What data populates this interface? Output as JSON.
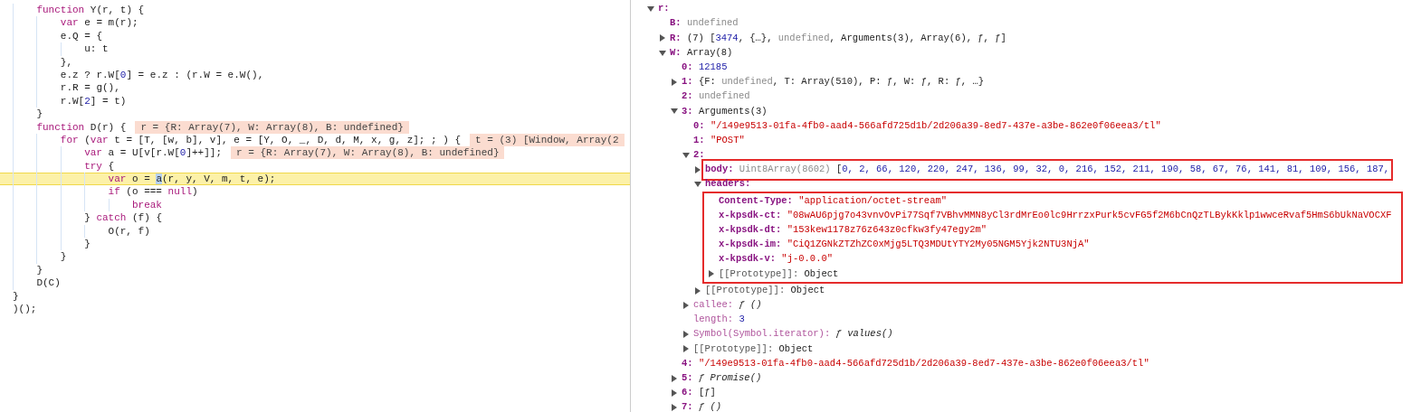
{
  "source": {
    "lines": [
      {
        "tokens": [
          {
            "kind": "kw",
            "text": "    function"
          },
          {
            "kind": "plain",
            "text": " Y(r, t) {"
          }
        ]
      },
      {
        "tokens": [
          {
            "kind": "kw",
            "text": "        var"
          },
          {
            "kind": "plain",
            "text": " e = m(r);"
          }
        ]
      },
      {
        "tokens": [
          {
            "kind": "plain",
            "text": "        e.Q = {"
          }
        ]
      },
      {
        "tokens": [
          {
            "kind": "plain",
            "text": "            u: t"
          }
        ]
      },
      {
        "tokens": [
          {
            "kind": "plain",
            "text": "        },"
          }
        ]
      },
      {
        "tokens": [
          {
            "kind": "plain",
            "text": "        e.z ? r.W["
          },
          {
            "kind": "num",
            "text": "0"
          },
          {
            "kind": "plain",
            "text": "] = e.z : (r.W = e.W(),"
          }
        ]
      },
      {
        "tokens": [
          {
            "kind": "plain",
            "text": "        r.R = g(),"
          }
        ]
      },
      {
        "tokens": [
          {
            "kind": "plain",
            "text": "        r.W["
          },
          {
            "kind": "num",
            "text": "2"
          },
          {
            "kind": "plain",
            "text": "] = t)"
          }
        ]
      },
      {
        "tokens": [
          {
            "kind": "plain",
            "text": "    }"
          }
        ]
      },
      {
        "tokens": [
          {
            "kind": "kw",
            "text": "    function"
          },
          {
            "kind": "plain",
            "text": " D(r) {"
          }
        ],
        "annotation": "r = {R: Array(7), W: Array(8), B: undefined}"
      },
      {
        "tokens": [
          {
            "kind": "kw",
            "text": "        for"
          },
          {
            "kind": "plain",
            "text": " ("
          },
          {
            "kind": "kw",
            "text": "var"
          },
          {
            "kind": "plain",
            "text": " t = [T, [w, b], v], e = [Y, O, _, D, d, M, x, g, z]; ; ) {"
          }
        ],
        "annotation": "t = (3) [Window, Array(2"
      },
      {
        "tokens": [
          {
            "kind": "kw",
            "text": "            var"
          },
          {
            "kind": "plain",
            "text": " a = U[v[r.W["
          },
          {
            "kind": "num",
            "text": "0"
          },
          {
            "kind": "plain",
            "text": "]++]];"
          }
        ],
        "annotation": "r = {R: Array(7), W: Array(8), B: undefined}"
      },
      {
        "tokens": [
          {
            "kind": "kw",
            "text": "            try"
          },
          {
            "kind": "plain",
            "text": " {"
          }
        ]
      },
      {
        "tokens": [
          {
            "kind": "kw",
            "text": "                var"
          },
          {
            "kind": "plain",
            "text": " o = "
          },
          {
            "kind": "sel",
            "text": "a"
          },
          {
            "kind": "plain",
            "text": "(r, y, V, m, t, e);"
          }
        ],
        "current": true
      },
      {
        "tokens": [
          {
            "kind": "kw",
            "text": "                if"
          },
          {
            "kind": "plain",
            "text": " (o === "
          },
          {
            "kind": "kw",
            "text": "null"
          },
          {
            "kind": "plain",
            "text": ")"
          }
        ]
      },
      {
        "tokens": [
          {
            "kind": "kw",
            "text": "                    break"
          }
        ]
      },
      {
        "tokens": [
          {
            "kind": "plain",
            "text": "            } "
          },
          {
            "kind": "kw",
            "text": "catch"
          },
          {
            "kind": "plain",
            "text": " (f) {"
          }
        ]
      },
      {
        "tokens": [
          {
            "kind": "plain",
            "text": "                O(r, f)"
          }
        ]
      },
      {
        "tokens": [
          {
            "kind": "plain",
            "text": "            }"
          }
        ]
      },
      {
        "tokens": [
          {
            "kind": "plain",
            "text": "        }"
          }
        ]
      },
      {
        "tokens": [
          {
            "kind": "plain",
            "text": "    }"
          }
        ]
      },
      {
        "tokens": [
          {
            "kind": "plain",
            "text": "    D(C)"
          }
        ]
      },
      {
        "tokens": [
          {
            "kind": "plain",
            "text": "}"
          }
        ]
      },
      {
        "tokens": [
          {
            "kind": "plain",
            "text": ")();"
          }
        ]
      }
    ]
  },
  "scope": {
    "tree": [
      {
        "key": "r:",
        "kind": "own",
        "expanded": true,
        "children": [
          {
            "key": "B:",
            "kind": "own",
            "value": [
              {
                "kind": "undef",
                "text": "undefined"
              }
            ]
          },
          {
            "key": "R:",
            "kind": "own",
            "expanded": false,
            "value": [
              {
                "kind": "plain",
                "text": "(7) ["
              },
              {
                "kind": "num",
                "text": "3474"
              },
              {
                "kind": "plain",
                "text": ", {…}, "
              },
              {
                "kind": "undef",
                "text": "undefined"
              },
              {
                "kind": "plain",
                "text": ", Arguments(3), Array(6), ƒ, ƒ]"
              }
            ]
          },
          {
            "key": "W:",
            "kind": "own",
            "expanded": true,
            "value": [
              {
                "kind": "plain",
                "text": "Array(8)"
              }
            ],
            "children": [
              {
                "key": "0:",
                "kind": "index",
                "value": [
                  {
                    "kind": "num",
                    "text": "12185"
                  }
                ]
              },
              {
                "key": "1:",
                "kind": "index",
                "expanded": false,
                "value": [
                  {
                    "kind": "plain",
                    "text": "{F: "
                  },
                  {
                    "kind": "undef",
                    "text": "undefined"
                  },
                  {
                    "kind": "plain",
                    "text": ", T: Array(510), P: ƒ, W: ƒ, R: ƒ, …}"
                  }
                ]
              },
              {
                "key": "2:",
                "kind": "index",
                "value": [
                  {
                    "kind": "undef",
                    "text": "undefined"
                  }
                ]
              },
              {
                "key": "3:",
                "kind": "index",
                "expanded": true,
                "value": [
                  {
                    "kind": "plain",
                    "text": "Arguments(3)"
                  }
                ],
                "children": [
                  {
                    "key": "0:",
                    "kind": "index",
                    "value": [
                      {
                        "kind": "str",
                        "text": "\"/149e9513-01fa-4fb0-aad4-566afd725d1b/2d206a39-8ed7-437e-a3be-862e0f06eea3/tl\""
                      }
                    ]
                  },
                  {
                    "key": "1:",
                    "kind": "index",
                    "value": [
                      {
                        "kind": "str",
                        "text": "\"POST\""
                      }
                    ]
                  },
                  {
                    "key": "2:",
                    "kind": "index",
                    "expanded": true,
                    "children": [
                      {
                        "key": "body:",
                        "kind": "own",
                        "expanded": false,
                        "outlined": true,
                        "value": [
                          {
                            "kind": "undef",
                            "text": "Uint8Array(8602)"
                          },
                          {
                            "kind": "plain",
                            "text": " ["
                          },
                          {
                            "kind": "num",
                            "text": "0, 2, 66, 120, 220, 247, 136, 99, 32, 0, 216, 152, 211, 190, 58, 67, 76, 141, 81, 109, 156, 187,"
                          }
                        ]
                      },
                      {
                        "key": "headers:",
                        "kind": "own",
                        "expanded": true,
                        "children_outlined": true,
                        "children": [
                          {
                            "key": "Content-Type:",
                            "kind": "own",
                            "value": [
                              {
                                "kind": "str",
                                "text": "\"application/octet-stream\""
                              }
                            ]
                          },
                          {
                            "key": "x-kpsdk-ct:",
                            "kind": "own",
                            "value": [
                              {
                                "kind": "str",
                                "text": "\"08wAU6pjg7o43vnvOvPi77Sqf7VBhvMMN8yCl3rdMrEo0lc9HrrzxPurk5cvFG5f2M6bCnQzTLBykKklp1wwceRvaf5HmS6bUkNaVOCXF"
                              }
                            ]
                          },
                          {
                            "key": "x-kpsdk-dt:",
                            "kind": "own",
                            "value": [
                              {
                                "kind": "str",
                                "text": "\"153kew1178z76z643z0cfkw3fy47egy2m\""
                              }
                            ]
                          },
                          {
                            "key": "x-kpsdk-im:",
                            "kind": "own",
                            "value": [
                              {
                                "kind": "str",
                                "text": "\"CiQ1ZGNkZTZhZC0xMjg5LTQ3MDUtYTY2My05NGM5Yjk2NTU3NjA\""
                              }
                            ]
                          },
                          {
                            "key": "x-kpsdk-v:",
                            "kind": "own",
                            "value": [
                              {
                                "kind": "str",
                                "text": "\"j-0.0.0\""
                              }
                            ]
                          },
                          {
                            "key": "[[Prototype]]:",
                            "kind": "internal",
                            "expanded": false,
                            "value": [
                              {
                                "kind": "plain",
                                "text": "Object"
                              }
                            ]
                          }
                        ]
                      },
                      {
                        "key": "[[Prototype]]:",
                        "kind": "internal",
                        "expanded": false,
                        "value": [
                          {
                            "kind": "plain",
                            "text": "Object"
                          }
                        ]
                      }
                    ]
                  },
                  {
                    "key": "callee:",
                    "kind": "inherited",
                    "expanded": false,
                    "value": [
                      {
                        "kind": "fn",
                        "text": "ƒ ()"
                      }
                    ]
                  },
                  {
                    "key": "length:",
                    "kind": "inherited",
                    "value": [
                      {
                        "kind": "num",
                        "text": "3"
                      }
                    ]
                  },
                  {
                    "key": "Symbol(Symbol.iterator):",
                    "kind": "inherited",
                    "expanded": false,
                    "value": [
                      {
                        "kind": "fn",
                        "text": "ƒ values()"
                      }
                    ]
                  },
                  {
                    "key": "[[Prototype]]:",
                    "kind": "internal",
                    "expanded": false,
                    "value": [
                      {
                        "kind": "plain",
                        "text": "Object"
                      }
                    ]
                  }
                ]
              },
              {
                "key": "4:",
                "kind": "index",
                "value": [
                  {
                    "kind": "str",
                    "text": "\"/149e9513-01fa-4fb0-aad4-566afd725d1b/2d206a39-8ed7-437e-a3be-862e0f06eea3/tl\""
                  }
                ]
              },
              {
                "key": "5:",
                "kind": "index",
                "expanded": false,
                "value": [
                  {
                    "kind": "fn",
                    "text": "ƒ Promise()"
                  }
                ]
              },
              {
                "key": "6:",
                "kind": "index",
                "expanded": false,
                "value": [
                  {
                    "kind": "plain",
                    "text": "[ƒ]"
                  }
                ]
              },
              {
                "key": "7:",
                "kind": "index",
                "expanded": false,
                "value": [
                  {
                    "kind": "fn",
                    "text": "ƒ ()"
                  }
                ]
              }
            ]
          }
        ]
      }
    ]
  }
}
